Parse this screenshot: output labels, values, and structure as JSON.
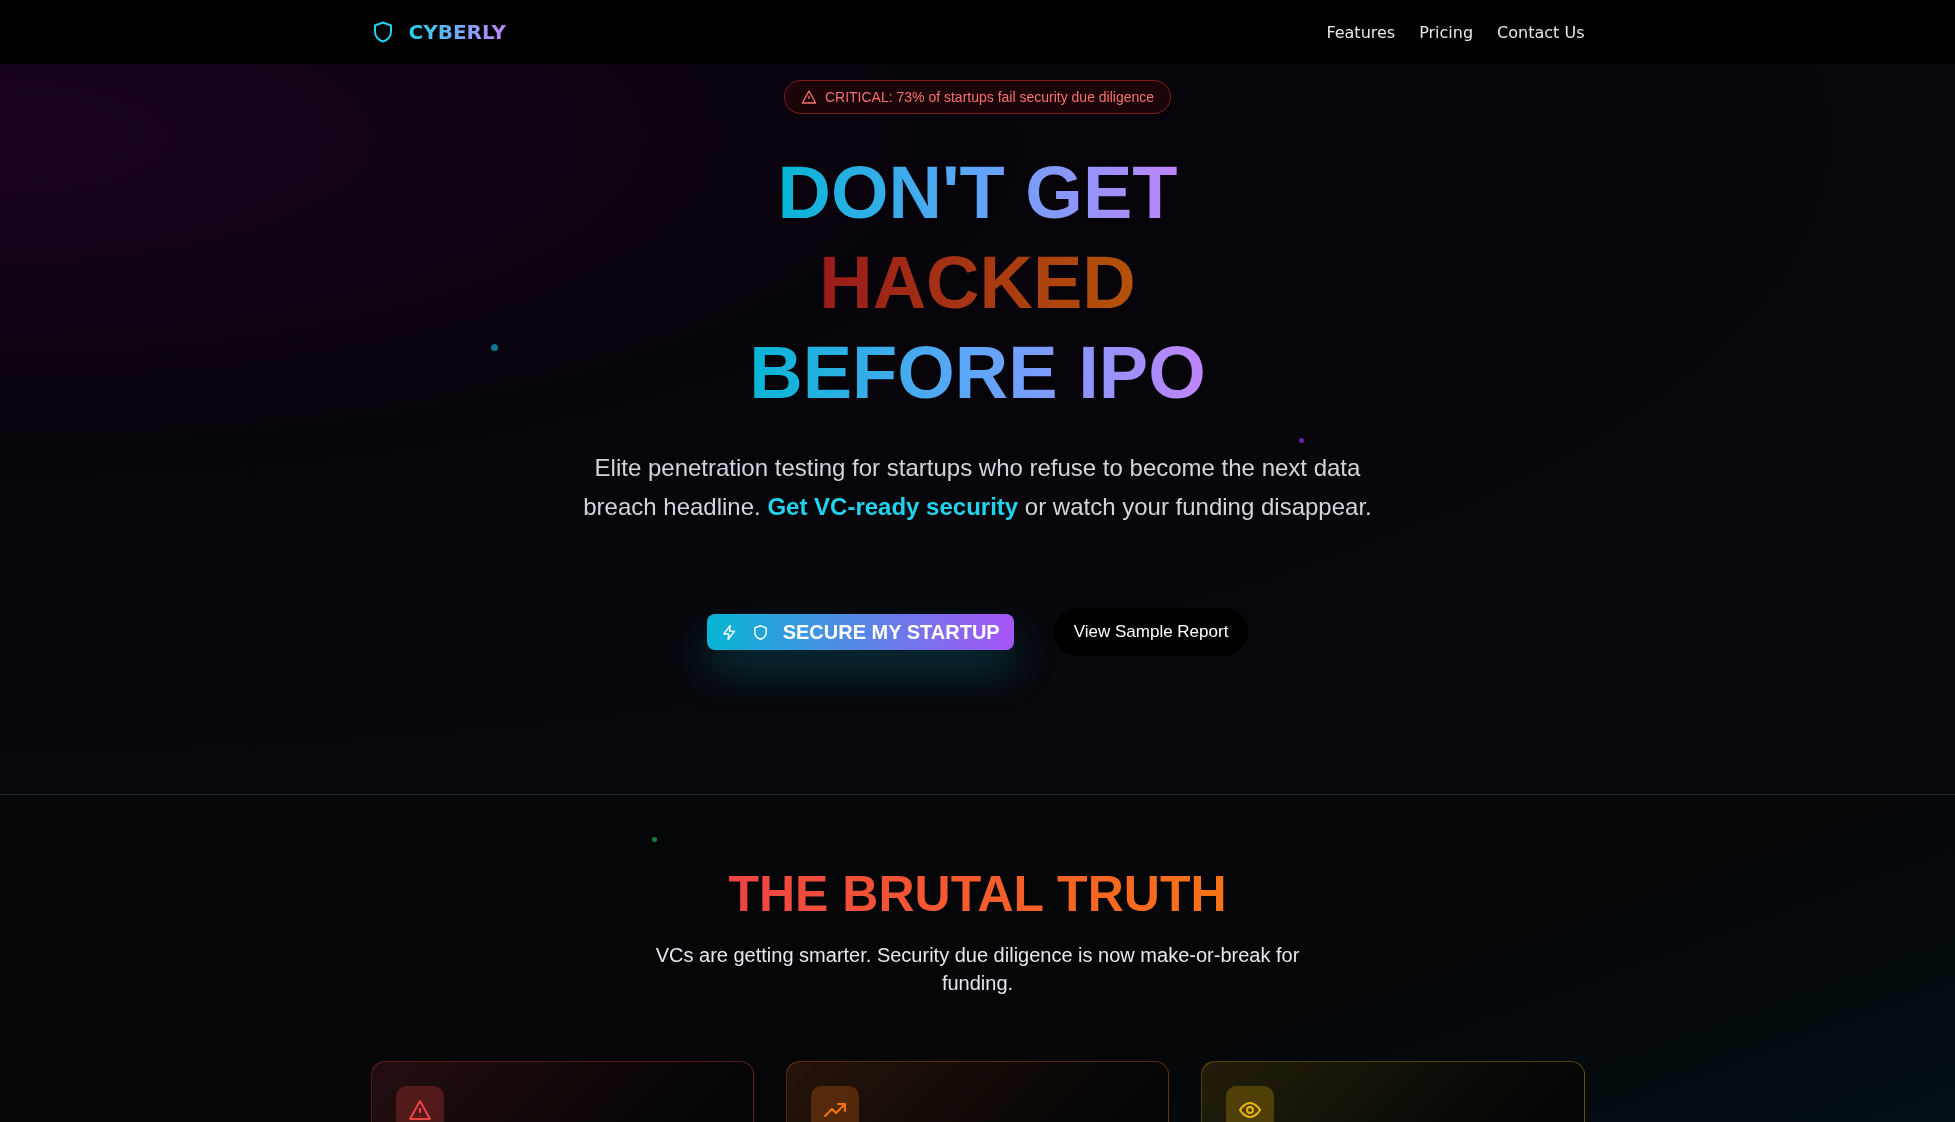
{
  "nav": {
    "brand": "CYBERLY",
    "links": [
      "Features",
      "Pricing",
      "Contact Us"
    ]
  },
  "hero": {
    "alert": "CRITICAL: 73% of startups fail security due diligence",
    "title_lines": [
      {
        "text": "DON'T GET",
        "kind": "primary"
      },
      {
        "text": "HACKED",
        "kind": "danger"
      },
      {
        "text": "BEFORE IPO",
        "kind": "primary"
      }
    ],
    "lead": "Elite penetration testing for startups who refuse to become the next data breach headline. **Get VC-ready security** or watch your funding disappear.",
    "primary_button": "SECURE MY STARTUP",
    "secondary_button": "View Sample Report"
  },
  "truth": {
    "title": "THE BRUTAL TRUTH",
    "subtitle": "VCs are getting smarter. Security due diligence is now make-or-break for funding.",
    "cards": [
      {
        "kind": "warning",
        "color": "#ef4444"
      },
      {
        "kind": "trend",
        "color": "#f97316"
      },
      {
        "kind": "eye",
        "color": "#eab308"
      }
    ]
  }
}
